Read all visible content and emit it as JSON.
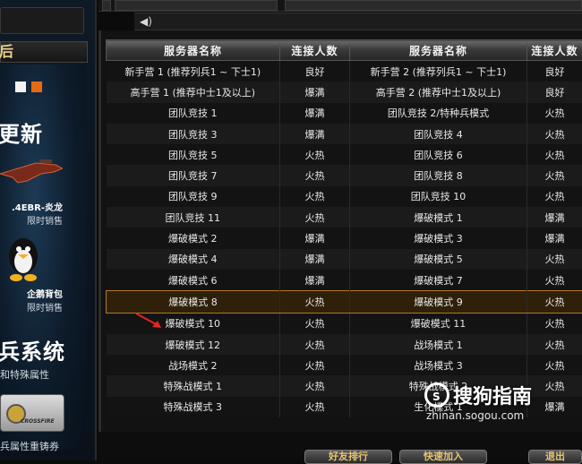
{
  "sidebar": {
    "tab_label": "后",
    "title1": "更新",
    "item1_name": ".4EBR-炎龙",
    "item1_sub": "限时销售",
    "item2_name": "企鹅背包",
    "item2_sub": "限时销售",
    "title2": "兵系统",
    "desc": "和特殊属性",
    "card_text": "CROSSFIRE",
    "footer": "兵属性重铸券"
  },
  "table": {
    "headers": [
      "服务器名称",
      "连接人数",
      "服务器名称",
      "连接人数"
    ],
    "rows": [
      {
        "l_name": "新手营 1 (推荐列兵1 ~ 下士1)",
        "l_status": "良好",
        "l_cls": "good",
        "r_name": "新手营 2 (推荐列兵1 ~ 下士1)",
        "r_status": "良好",
        "r_cls": "good"
      },
      {
        "l_name": "高手营 1 (推荐中士1及以上)",
        "l_status": "爆满",
        "l_cls": "full",
        "r_name": "高手营 2 (推荐中士1及以上)",
        "r_status": "良好",
        "r_cls": "good"
      },
      {
        "l_name": "团队竞技 1",
        "l_status": "爆满",
        "l_cls": "full",
        "r_name": "团队竞技 2/特种兵模式",
        "r_status": "火热",
        "r_cls": "hot"
      },
      {
        "l_name": "团队竞技 3",
        "l_status": "爆满",
        "l_cls": "full",
        "r_name": "团队竞技 4",
        "r_status": "火热",
        "r_cls": "hot"
      },
      {
        "l_name": "团队竞技 5",
        "l_status": "火热",
        "l_cls": "hot",
        "r_name": "团队竞技 6",
        "r_status": "火热",
        "r_cls": "hot"
      },
      {
        "l_name": "团队竞技 7",
        "l_status": "火热",
        "l_cls": "hot",
        "r_name": "团队竞技 8",
        "r_status": "火热",
        "r_cls": "hot"
      },
      {
        "l_name": "团队竞技 9",
        "l_status": "火热",
        "l_cls": "hot",
        "r_name": "团队竞技 10",
        "r_status": "火热",
        "r_cls": "hot"
      },
      {
        "l_name": "团队竞技 11",
        "l_status": "火热",
        "l_cls": "hot",
        "r_name": "爆破模式 1",
        "r_status": "爆满",
        "r_cls": "full"
      },
      {
        "l_name": "爆破模式 2",
        "l_status": "爆满",
        "l_cls": "full",
        "r_name": "爆破模式 3",
        "r_status": "爆满",
        "r_cls": "full"
      },
      {
        "l_name": "爆破模式 4",
        "l_status": "爆满",
        "l_cls": "full",
        "r_name": "爆破模式 5",
        "r_status": "火热",
        "r_cls": "hot"
      },
      {
        "l_name": "爆破模式 6",
        "l_status": "爆满",
        "l_cls": "full",
        "r_name": "爆破模式 7",
        "r_status": "火热",
        "r_cls": "hot"
      },
      {
        "l_name": "爆破模式 8",
        "l_status": "火热",
        "l_cls": "hot",
        "r_name": "爆破模式 9",
        "r_status": "火热",
        "r_cls": "hot",
        "selected": true
      },
      {
        "l_name": "爆破模式 10",
        "l_status": "火热",
        "l_cls": "hot",
        "r_name": "爆破模式 11",
        "r_status": "火热",
        "r_cls": "hot"
      },
      {
        "l_name": "爆破模式 12",
        "l_status": "火热",
        "l_cls": "hot",
        "r_name": "战场模式 1",
        "r_status": "火热",
        "r_cls": "hot"
      },
      {
        "l_name": "战场模式 2",
        "l_status": "火热",
        "l_cls": "hot",
        "r_name": "战场模式 3",
        "r_status": "火热",
        "r_cls": "hot"
      },
      {
        "l_name": "特殊战模式 1",
        "l_status": "火热",
        "l_cls": "hot",
        "r_name": "特殊战模式 2",
        "r_status": "火热",
        "r_cls": "hot"
      },
      {
        "l_name": "特殊战模式 3",
        "l_status": "火热",
        "l_cls": "hot",
        "r_name": "生化模式 1",
        "r_status": "爆满",
        "r_cls": "full"
      }
    ]
  },
  "bottom": {
    "btn1": "好友排行",
    "btn2": "快速加入",
    "btn3": "退出"
  },
  "watermark": {
    "title": "搜狗指南",
    "url": "zhinan.sogou.com"
  },
  "colors": {
    "good": "#3cc23c",
    "full": "#ff3b28",
    "hot": "#f4a21a",
    "header_text": "#f2f2f2",
    "selected_border": "#b27c22"
  }
}
